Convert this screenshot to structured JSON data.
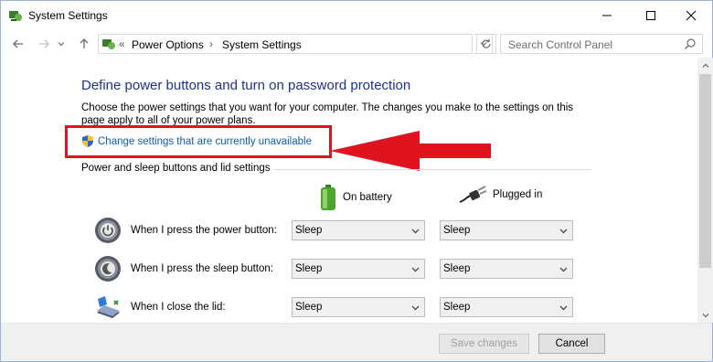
{
  "window": {
    "title": "System Settings",
    "controls": {
      "minimize": "minimize-icon",
      "maximize": "maximize-icon",
      "close": "close-icon"
    }
  },
  "navigation": {
    "breadcrumb_prefix": "«",
    "breadcrumbs": [
      "Power Options",
      "System Settings"
    ],
    "separator": "›",
    "search_placeholder": "Search Control Panel"
  },
  "main": {
    "heading": "Define power buttons and turn on password protection",
    "description": "Choose the power settings that you want for your computer. The changes you make to the settings on this page apply to all of your power plans.",
    "change_link": "Change settings that are currently unavailable",
    "group_title": "Power and sleep buttons and lid settings",
    "columns": {
      "battery": "On battery",
      "plugged": "Plugged in"
    },
    "rows": [
      {
        "label": "When I press the power button:",
        "battery": "Sleep",
        "plugged": "Sleep",
        "icon": "power-button-icon"
      },
      {
        "label": "When I press the sleep button:",
        "battery": "Sleep",
        "plugged": "Sleep",
        "icon": "sleep-button-icon"
      },
      {
        "label": "When I close the lid:",
        "battery": "Sleep",
        "plugged": "Sleep",
        "icon": "laptop-lid-icon"
      }
    ]
  },
  "footer": {
    "save_label": "Save changes",
    "cancel_label": "Cancel"
  },
  "colors": {
    "heading": "#1e3287",
    "link": "#0b5ea8",
    "annotation_red": "#e0141e"
  }
}
